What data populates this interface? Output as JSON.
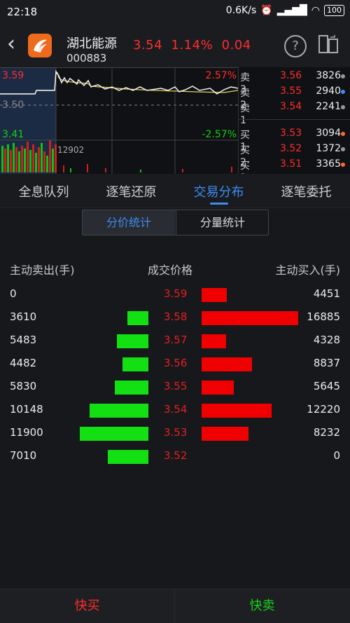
{
  "status": {
    "time": "22:18",
    "speed": "0.6K/s",
    "battery": "100"
  },
  "header": {
    "name": "湖北能源",
    "code": "000883",
    "price": "3.54",
    "pct": "1.14%",
    "chg": "0.04",
    "help": "?"
  },
  "mini_chart": {
    "high": "3.59",
    "high_pct": "2.57%",
    "mid": "3.50",
    "low": "3.41",
    "low_pct": "-2.57%",
    "vol": "12902"
  },
  "orderbook": [
    {
      "label": "卖3",
      "price": "3.56",
      "vol": "3826",
      "dot": "#999999"
    },
    {
      "label": "卖2",
      "price": "3.55",
      "vol": "2940",
      "dot": "#3d8df0"
    },
    {
      "label": "卖1",
      "price": "3.54",
      "vol": "2241",
      "dot": "#999999"
    },
    {
      "label": "买1",
      "price": "3.53",
      "vol": "3094",
      "dot": "#ff6a2a"
    },
    {
      "label": "买2",
      "price": "3.52",
      "vol": "1372",
      "dot": "#999999"
    },
    {
      "label": "买3",
      "price": "3.51",
      "vol": "3365",
      "dot": "#ff6a2a"
    }
  ],
  "tabs": [
    "全息队列",
    "逐笔还原",
    "交易分布",
    "逐笔委托"
  ],
  "segments": {
    "a": "分价统计",
    "b": "分量统计"
  },
  "columns": {
    "sell": "主动卖出(手)",
    "price": "成交价格",
    "buy": "主动买入(手)"
  },
  "rows": [
    {
      "sell": "0",
      "price": "3.59",
      "buy": "4451"
    },
    {
      "sell": "3610",
      "price": "3.58",
      "buy": "16885"
    },
    {
      "sell": "5483",
      "price": "3.57",
      "buy": "4328"
    },
    {
      "sell": "4482",
      "price": "3.56",
      "buy": "8837"
    },
    {
      "sell": "5830",
      "price": "3.55",
      "buy": "5645"
    },
    {
      "sell": "10148",
      "price": "3.54",
      "buy": "12220"
    },
    {
      "sell": "11900",
      "price": "3.53",
      "buy": "8232"
    },
    {
      "sell": "7010",
      "price": "3.52",
      "buy": "0"
    }
  ],
  "bottom": {
    "buy": "快买",
    "sell": "快卖"
  }
}
